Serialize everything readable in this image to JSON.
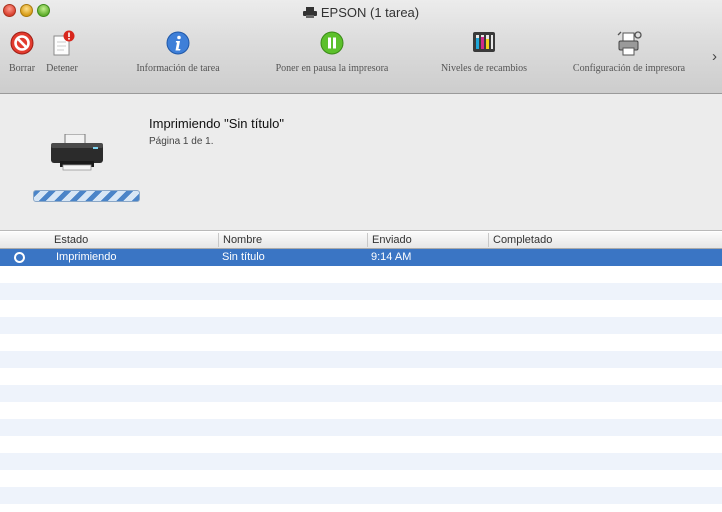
{
  "window": {
    "title": "EPSON (1 tarea)"
  },
  "toolbar": {
    "items": [
      {
        "label": "Borrar",
        "icon": "delete-icon"
      },
      {
        "label": "Detener",
        "icon": "hold-icon"
      },
      {
        "label": "Información de tarea",
        "icon": "info-icon"
      },
      {
        "label": "Poner en pausa la impresora",
        "icon": "pause-icon"
      },
      {
        "label": "Niveles de recambios",
        "icon": "ink-levels-icon"
      },
      {
        "label": "Configuración de impresora",
        "icon": "printer-setup-icon"
      }
    ],
    "overflow": "›"
  },
  "job": {
    "title": "Imprimiendo \"Sin título\"",
    "page": "Página 1 de 1.",
    "progress": "indeterminate"
  },
  "table": {
    "columns": [
      "Estado",
      "Nombre",
      "Enviado",
      "Completado"
    ],
    "rows": [
      {
        "estado": "Imprimiendo",
        "nombre": "Sin título",
        "enviado": "9:14 AM",
        "completado": ""
      }
    ]
  },
  "colors": {
    "selection": "#3a75c4",
    "stripe": "#eef3fb",
    "progress": "#4a84c8"
  }
}
